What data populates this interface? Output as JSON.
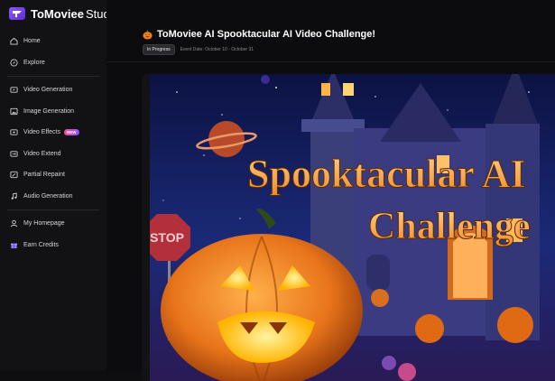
{
  "brand": {
    "name": "ToMoviee",
    "suffix": "Studio"
  },
  "sidebar": {
    "items": [
      {
        "label": "Home",
        "icon": "home-icon"
      },
      {
        "label": "Explore",
        "icon": "compass-icon"
      },
      {
        "label": "Video Generation",
        "icon": "video-icon"
      },
      {
        "label": "Image Generation",
        "icon": "image-icon"
      },
      {
        "label": "Video Effects",
        "icon": "sparkle-video-icon",
        "badge": "NEW"
      },
      {
        "label": "Video Extend",
        "icon": "extend-icon"
      },
      {
        "label": "Partial Repaint",
        "icon": "brush-icon"
      },
      {
        "label": "Audio Generation",
        "icon": "music-icon"
      },
      {
        "label": "My Homepage",
        "icon": "user-icon"
      },
      {
        "label": "Earn Credits",
        "icon": "gift-icon"
      }
    ]
  },
  "event": {
    "title": "ToMoviee AI Spooktacular AI Video Challenge!",
    "status": "In Progress",
    "date": "Event Date: October 10 - October 31",
    "banner_line1": "Spooktacular AI",
    "banner_line2": "Challenge",
    "stop_sign": "STOP"
  },
  "colors": {
    "accent": "#7b48ff",
    "pumpkin": "#f08a1c",
    "sky": "#141a4a",
    "title_orange": "#f5a34a"
  }
}
